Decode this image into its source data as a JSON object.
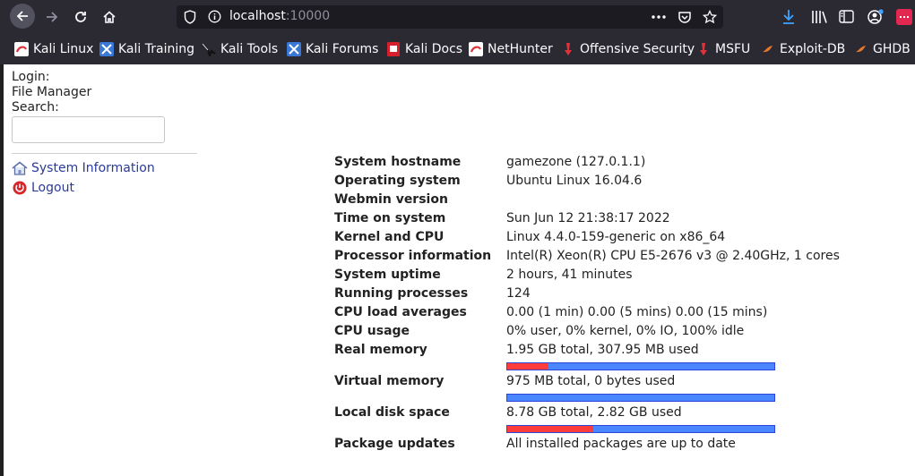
{
  "browser": {
    "url_host": "localhost",
    "url_port": ":10000",
    "bookmarks": [
      {
        "label": "Kali Linux",
        "icon": "kali-icon"
      },
      {
        "label": "Kali Training",
        "icon": "kali-training-icon"
      },
      {
        "label": "Kali Tools",
        "icon": "kali-tools-icon"
      },
      {
        "label": "Kali Forums",
        "icon": "kali-forums-icon"
      },
      {
        "label": "Kali Docs",
        "icon": "kali-docs-icon"
      },
      {
        "label": "NetHunter",
        "icon": "nethunter-icon"
      },
      {
        "label": "Offensive Security",
        "icon": "offsec-icon"
      },
      {
        "label": "MSFU",
        "icon": "msfu-icon"
      },
      {
        "label": "Exploit-DB",
        "icon": "exploitdb-icon"
      },
      {
        "label": "GHDB",
        "icon": "ghdb-icon"
      }
    ]
  },
  "sidebar": {
    "login_label": "Login:",
    "file_manager": "File Manager",
    "search_label": "Search:",
    "search_value": "",
    "system_info": "System Information",
    "logout": "Logout"
  },
  "info": [
    {
      "label": "System hostname",
      "value": "gamezone (127.0.1.1)"
    },
    {
      "label": "Operating system",
      "value": "Ubuntu Linux 16.04.6"
    },
    {
      "label": "Webmin version",
      "value": ""
    },
    {
      "label": "Time on system",
      "value": "Sun Jun 12 21:38:17 2022"
    },
    {
      "label": "Kernel and CPU",
      "value": "Linux 4.4.0-159-generic on x86_64"
    },
    {
      "label": "Processor information",
      "value": "Intel(R) Xeon(R) CPU E5-2676 v3 @ 2.40GHz, 1 cores"
    },
    {
      "label": "System uptime",
      "value": "2 hours, 41 minutes"
    },
    {
      "label": "Running processes",
      "value": "124"
    },
    {
      "label": "CPU load averages",
      "value": "0.00 (1 min) 0.00 (5 mins) 0.00 (15 mins)"
    },
    {
      "label": "CPU usage",
      "value": "0% user, 0% kernel, 0% IO, 100% idle"
    },
    {
      "label": "Real memory",
      "value": "1.95 GB total, 307.95 MB used",
      "usage": 0.154
    },
    {
      "label": "Virtual memory",
      "value": "975 MB total, 0 bytes used",
      "usage": 0.0
    },
    {
      "label": "Local disk space",
      "value": "8.78 GB total, 2.82 GB used",
      "usage": 0.321
    },
    {
      "label": "Package updates",
      "value": "All installed packages are up to date"
    }
  ],
  "colors": {
    "bar_used": "#ff3b3b",
    "bar_free": "#4a86ff",
    "link": "#2a3a9a",
    "chrome_bg": "#2b2a33"
  }
}
